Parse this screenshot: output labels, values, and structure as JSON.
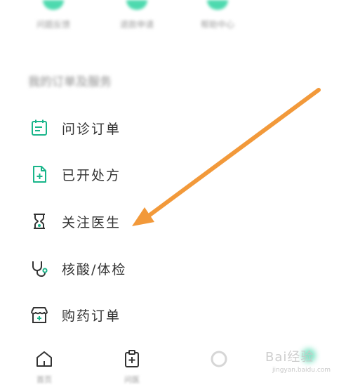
{
  "top_actions": [
    {
      "label": "问题反馈",
      "icon": "blurred-icon"
    },
    {
      "label": "退款申请",
      "icon": "blurred-icon"
    },
    {
      "label": "帮助中心",
      "icon": "blurred-icon"
    }
  ],
  "section": {
    "title": "我的订单及服务"
  },
  "menu": [
    {
      "label": "问诊订单",
      "icon": "calendar-list-icon"
    },
    {
      "label": "已开处方",
      "icon": "prescription-plus-icon"
    },
    {
      "label": "关注医生",
      "icon": "hourglass-doctor-icon"
    },
    {
      "label": "核酸/体检",
      "icon": "stethoscope-icon"
    },
    {
      "label": "购药订单",
      "icon": "pharmacy-store-icon"
    }
  ],
  "tabbar": [
    {
      "label": "首页",
      "icon": "home-icon"
    },
    {
      "label": "问医",
      "icon": "clipboard-plus-icon"
    },
    {
      "label": "",
      "icon": "blurred-icon"
    },
    {
      "label": "",
      "icon": "blurred-icon"
    }
  ],
  "watermark": {
    "text": "Bai经验",
    "sub": "jingyan.baidu.com"
  },
  "colors": {
    "accent": "#19b58a",
    "arrow": "#f2993a",
    "text": "#333333"
  }
}
